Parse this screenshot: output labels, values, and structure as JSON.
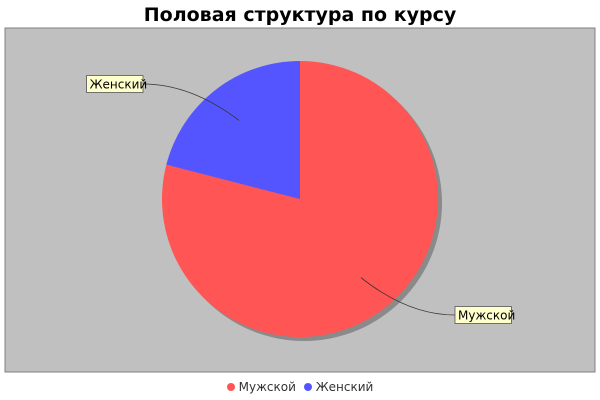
{
  "chart_data": {
    "type": "pie",
    "title": "Половая структура по курсу",
    "slices": [
      {
        "label": "Мужской",
        "value": 79,
        "color": "#ff5555"
      },
      {
        "label": "Женский",
        "value": 21,
        "color": "#5555ff"
      }
    ],
    "start_angle_deg": 0,
    "direction": "clockwise",
    "legend_position": "bottom",
    "plot_background": "#c0c0c0",
    "label_background": "#ffffcc"
  }
}
